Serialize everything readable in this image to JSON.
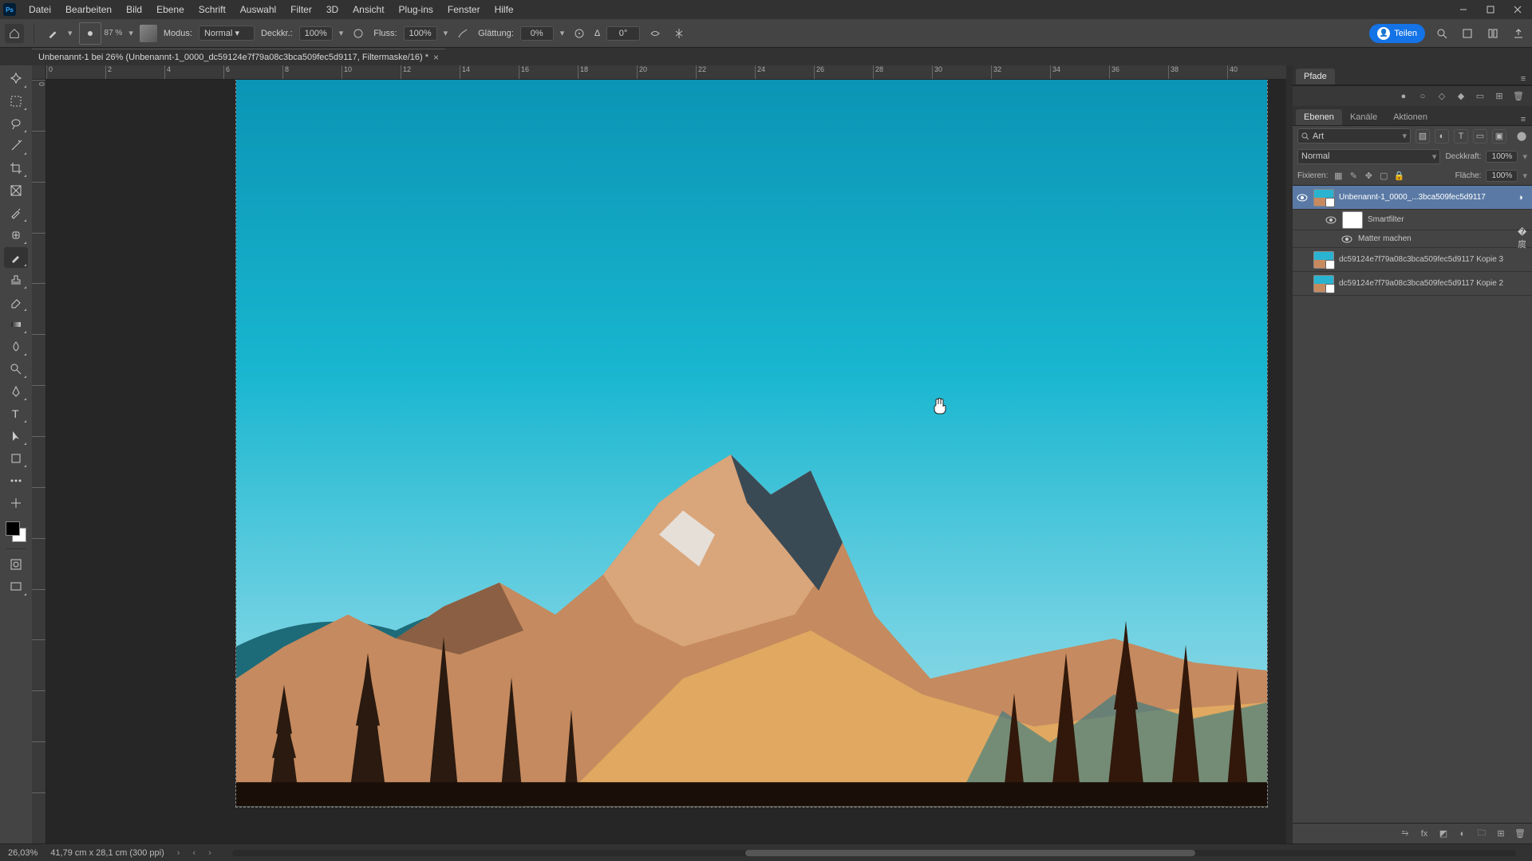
{
  "menubar": [
    "Datei",
    "Bearbeiten",
    "Bild",
    "Ebene",
    "Schrift",
    "Auswahl",
    "Filter",
    "3D",
    "Ansicht",
    "Plug-ins",
    "Fenster",
    "Hilfe"
  ],
  "optionsbar": {
    "brush_size": "87 %",
    "mode_label": "Modus:",
    "mode_value": "Normal",
    "opacity_label": "Deckkr.:",
    "opacity_value": "100%",
    "flow_label": "Fluss:",
    "flow_value": "100%",
    "smooth_label": "Glättung:",
    "smooth_value": "0%",
    "angle_label": "∆",
    "angle_value": "0°",
    "share": "Teilen"
  },
  "doctab": {
    "title": "Unbenannt-1 bei 26% (Unbenannt-1_0000_dc59124e7f79a08c3bca509fec5d9117, Filtermaske/16) *"
  },
  "ruler_h": [
    "0",
    "2",
    "4",
    "6",
    "8",
    "10",
    "12",
    "14",
    "16",
    "18",
    "20",
    "22",
    "24",
    "26",
    "28",
    "30",
    "32",
    "34",
    "36",
    "38",
    "40"
  ],
  "ruler_v": [
    "0",
    "",
    "",
    "",
    "",
    "",
    "",
    "",
    "",
    "",
    "",
    "",
    "",
    "",
    "",
    ""
  ],
  "panels": {
    "pfade_tab": "Pfade",
    "layers_tabs": [
      "Ebenen",
      "Kanäle",
      "Aktionen"
    ],
    "search_kind": "Art",
    "blend_mode": "Normal",
    "opacity_label": "Deckkraft:",
    "opacity_value": "100%",
    "fixieren_label": "Fixieren:",
    "fill_label": "Fläche:",
    "fill_value": "100%",
    "layers": [
      {
        "name": "Unbenannt-1_0000_...3bca509fec5d9117",
        "visible": true,
        "selected": true,
        "smart": true
      },
      {
        "name": "Smartfilter",
        "sub": true,
        "mask": true
      },
      {
        "name": "Matter machen",
        "subfilter": true
      },
      {
        "name": "dc59124e7f79a08c3bca509fec5d9117 Kopie 3",
        "smart": true
      },
      {
        "name": "dc59124e7f79a08c3bca509fec5d9117 Kopie 2",
        "smart": true
      }
    ]
  },
  "statusbar": {
    "zoom": "26,03%",
    "docsize": "41,79 cm x 28,1 cm (300 ppi)"
  }
}
